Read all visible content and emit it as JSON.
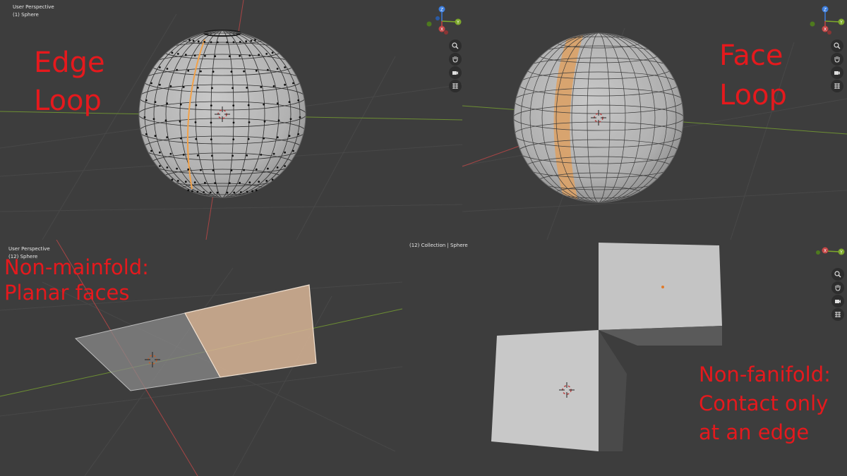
{
  "viewports": {
    "top_left": {
      "header_line1": "User Perspective",
      "header_line2": "(1) Sphere",
      "annotation_line1": "Edge",
      "annotation_line2": "Loop"
    },
    "top_right": {
      "annotation_line1": "Face",
      "annotation_line2": "Loop"
    },
    "bottom_left": {
      "header_line1": "User Perspective",
      "header_line2": "(12) Sphere",
      "annotation_line1": "Non-mainfold:",
      "annotation_line2": "Planar faces"
    },
    "bottom_right": {
      "header_center": "(12) Collection | Sphere",
      "annotation_line1": "Non-fanifold:",
      "annotation_line2": "Contact only",
      "annotation_line3": "at an edge"
    }
  },
  "gizmo": {
    "z_label": "Z",
    "y_label": "Y",
    "x_label": "X"
  },
  "nav_tools": [
    "zoom-icon",
    "hand-icon",
    "camera-icon",
    "grid-icon"
  ],
  "colors": {
    "background": "#3d3d3d",
    "annotation": "#e5191d",
    "selection": "#f2a24a",
    "x_axis": "#c44545",
    "y_axis": "#7ea82b",
    "z_axis": "#3b7dde"
  }
}
